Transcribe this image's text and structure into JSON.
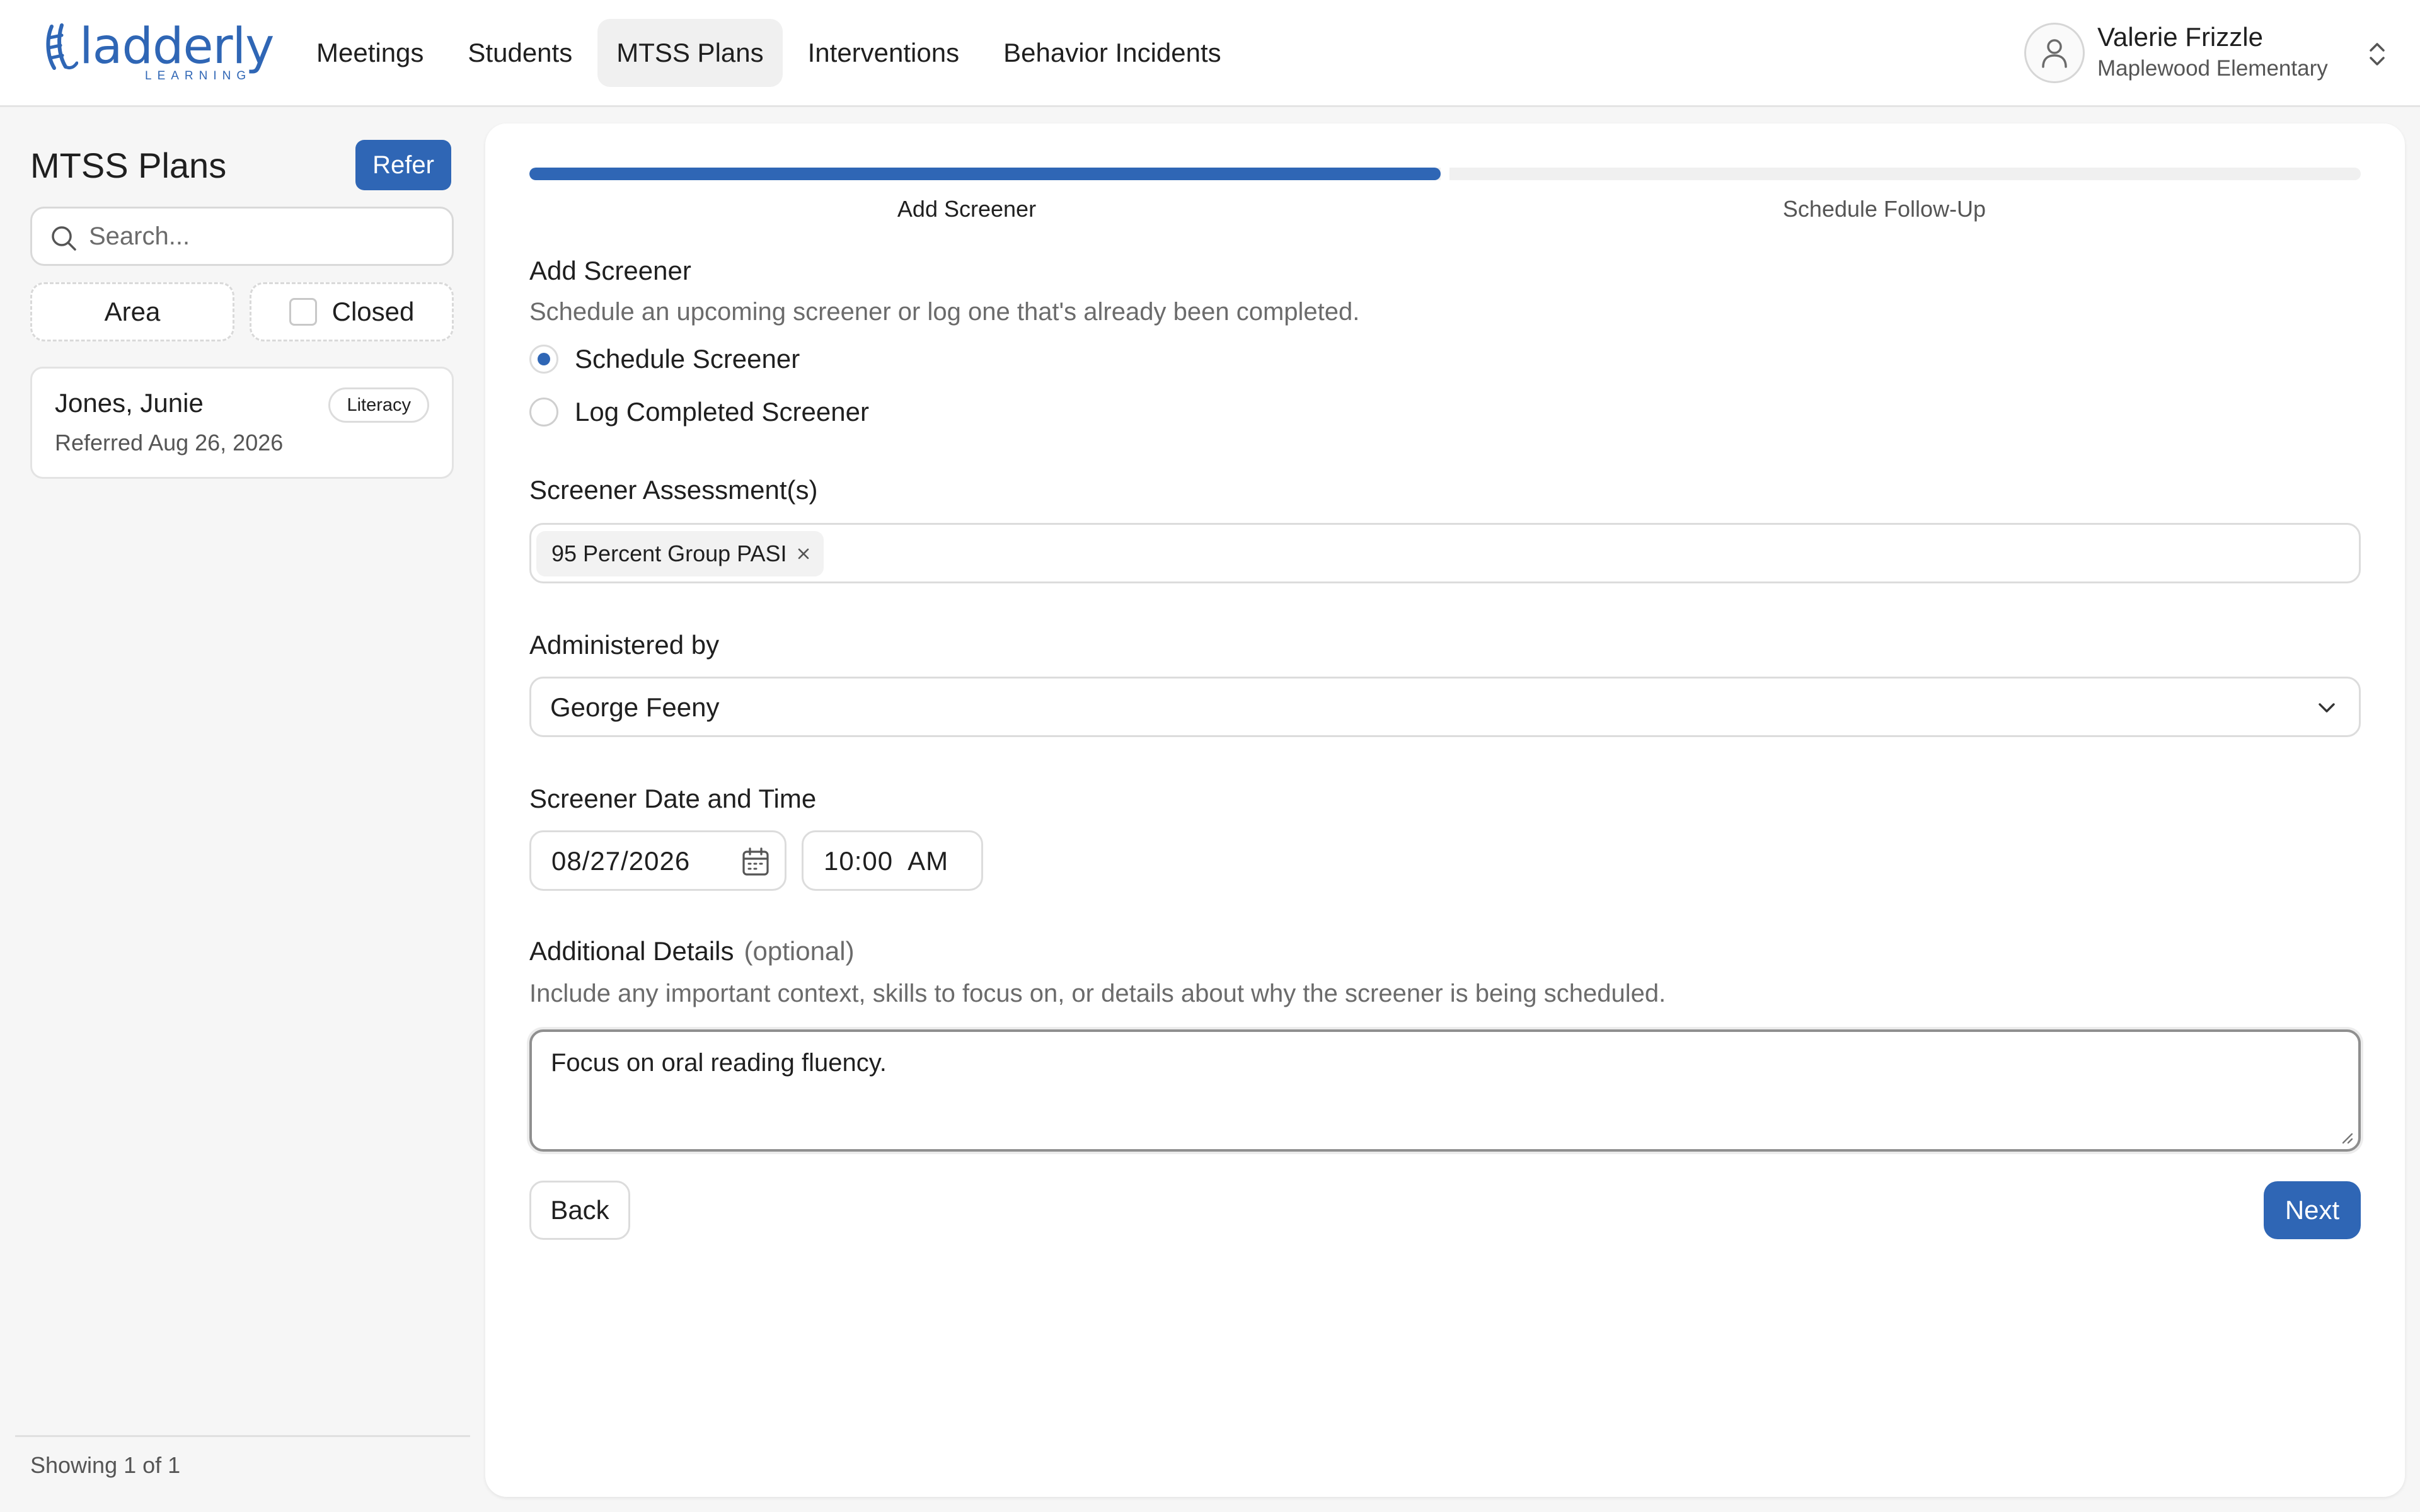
{
  "brand": {
    "name": "ladderly",
    "sub": "LEARNING",
    "color": "#2f66b5",
    "icon": "ladder-logo-icon"
  },
  "nav": {
    "items": [
      {
        "label": "Meetings",
        "active": false
      },
      {
        "label": "Students",
        "active": false
      },
      {
        "label": "MTSS Plans",
        "active": true
      },
      {
        "label": "Interventions",
        "active": false
      },
      {
        "label": "Behavior Incidents",
        "active": false
      }
    ]
  },
  "user": {
    "name": "Valerie Frizzle",
    "school": "Maplewood Elementary",
    "icon": "user-icon"
  },
  "sidebar": {
    "title": "MTSS Plans",
    "refer_label": "Refer",
    "search_placeholder": "Search...",
    "filter_area_label": "Area",
    "filter_closed_label": "Closed",
    "filter_closed_checked": false,
    "students": [
      {
        "name": "Jones, Junie",
        "tag": "Literacy",
        "referred": "Referred Aug 26, 2026"
      }
    ],
    "showing": "Showing 1 of 1"
  },
  "wizard": {
    "progress_fraction": 0.5,
    "steps": [
      {
        "label": "Add Screener",
        "active": true
      },
      {
        "label": "Schedule Follow-Up",
        "active": false
      }
    ],
    "accent_color": "#2f66b5"
  },
  "form": {
    "section_title": "Add Screener",
    "section_help": "Schedule an upcoming screener or log one that's already been completed.",
    "radio_options": [
      {
        "label": "Schedule Screener",
        "selected": true
      },
      {
        "label": "Log Completed Screener",
        "selected": false
      }
    ],
    "assessments_label": "Screener Assessment(s)",
    "assessments": [
      "95 Percent Group PASI"
    ],
    "administered_label": "Administered by",
    "administered_value": "George Feeny",
    "datetime_label": "Screener Date and Time",
    "date_value": "08/27/2026",
    "time_value": "10:00  AM",
    "details_label": "Additional Details",
    "details_optional": "(optional)",
    "details_help": "Include any important context, skills to focus on, or details about why the screener is being scheduled.",
    "details_value": "Focus on oral reading fluency.",
    "back_label": "Back",
    "next_label": "Next"
  }
}
